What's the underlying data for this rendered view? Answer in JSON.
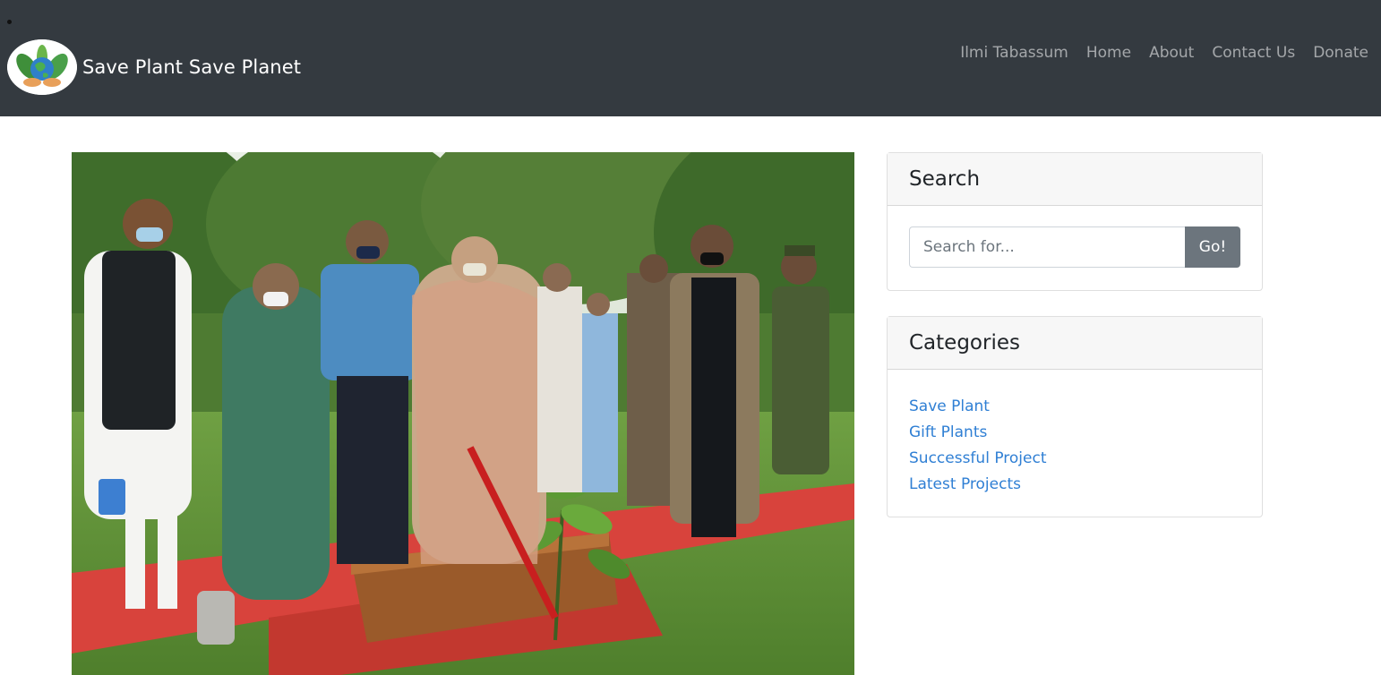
{
  "navbar": {
    "brand_title": "Save Plant Save Planet",
    "logo_icon": "globe-plant-logo-icon",
    "links": [
      {
        "label": "Ilmi Tabassum"
      },
      {
        "label": "Home"
      },
      {
        "label": "About"
      },
      {
        "label": "Contact Us"
      },
      {
        "label": "Donate"
      }
    ]
  },
  "hero": {
    "image": "tree-planting-ceremony-photo"
  },
  "sidebar": {
    "search": {
      "title": "Search",
      "placeholder": "Search for...",
      "button_label": "Go!"
    },
    "categories": {
      "title": "Categories",
      "items": [
        {
          "label": "Save Plant"
        },
        {
          "label": "Gift Plants"
        },
        {
          "label": "Successful Project"
        },
        {
          "label": "Latest Projects"
        }
      ]
    }
  },
  "colors": {
    "navbar_bg": "#343a40",
    "link": "#2f7fd4",
    "button": "#6c757d"
  }
}
